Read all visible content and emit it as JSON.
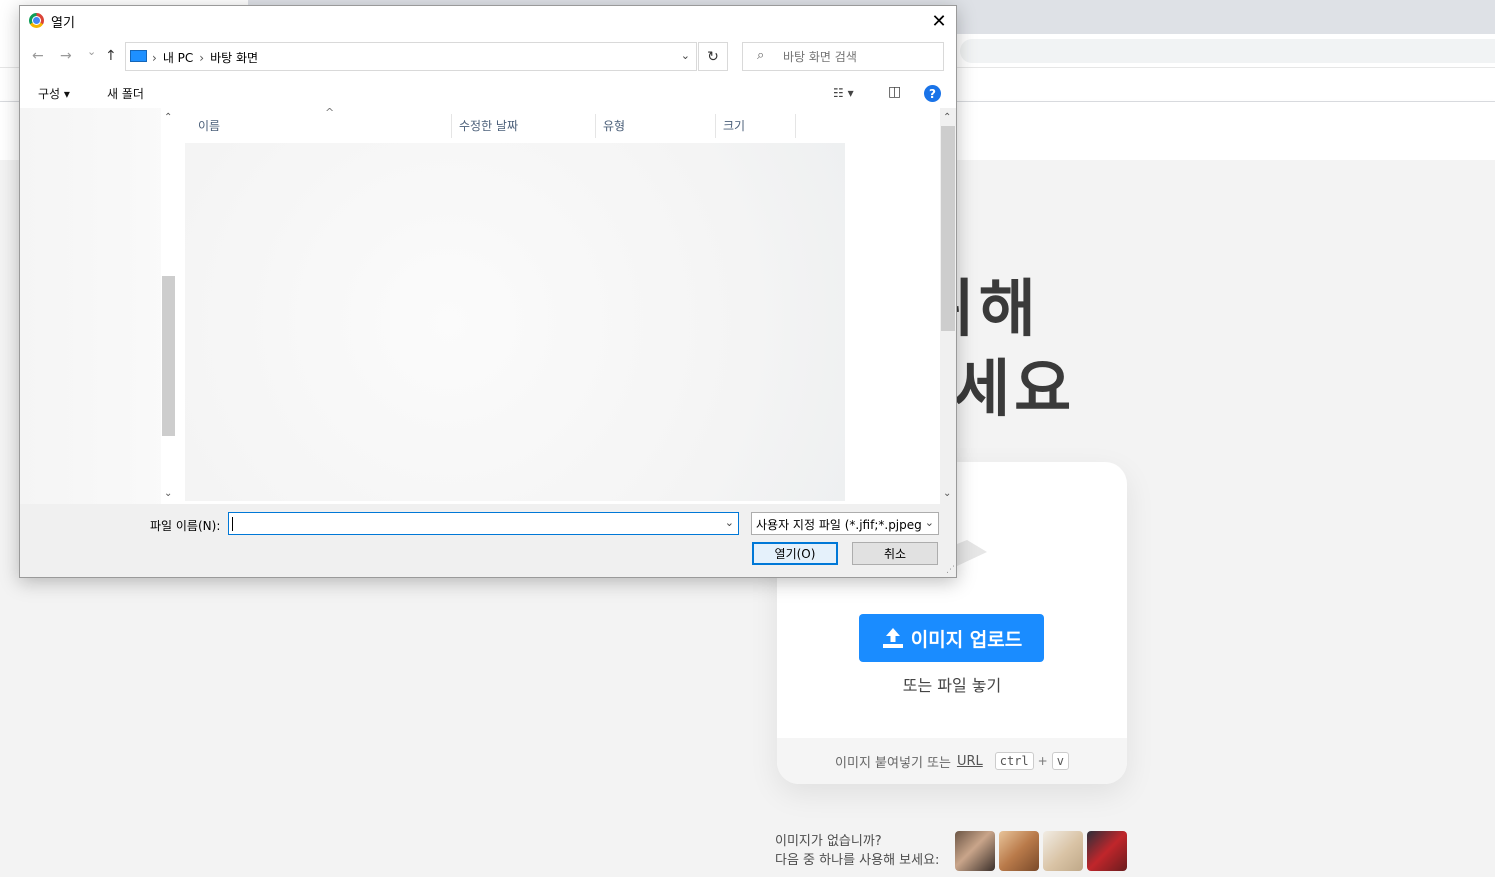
{
  "page": {
    "hero_line1": "어를 위해",
    "hero_line2": "로드하세요",
    "upload_button": "이미지 업로드",
    "drop_text": "또는 파일 놓기",
    "paste_text": "이미지 붙여넣기 또는",
    "paste_url": "URL",
    "kbd_ctrl": "ctrl",
    "kbd_plus": "+",
    "kbd_v": "v",
    "no_image_line1": "이미지가 없습니까?",
    "no_image_line2": "다음 중 하나를 사용해 보세요:",
    "sample_images": [
      "woman-photo",
      "dog-photo",
      "food-photo",
      "red-car-photo"
    ]
  },
  "dialog": {
    "title": "열기",
    "close_glyph": "✕",
    "nav": {
      "back": "←",
      "forward": "→",
      "recent": "⌄",
      "up": "↑"
    },
    "breadcrumbs": [
      "내 PC",
      "바탕 화면"
    ],
    "crumb_sep": "›",
    "refresh_glyph": "↻",
    "search_placeholder": "바탕 화면 검색",
    "commands": {
      "organize": "구성 ▾",
      "new_folder": "새 폴더"
    },
    "columns": [
      "이름",
      "수정한 날짜",
      "유형",
      "크기"
    ],
    "filename_label": "파일 이름(N):",
    "filename_value": "",
    "filetype_value": "사용자 지정 파일 (*.jfif;*.pjpeg",
    "open_button": "열기(O)",
    "cancel_button": "취소",
    "help_glyph": "?"
  },
  "colors": {
    "accent": "#1a8cff",
    "dialog_focus": "#0078d7"
  }
}
